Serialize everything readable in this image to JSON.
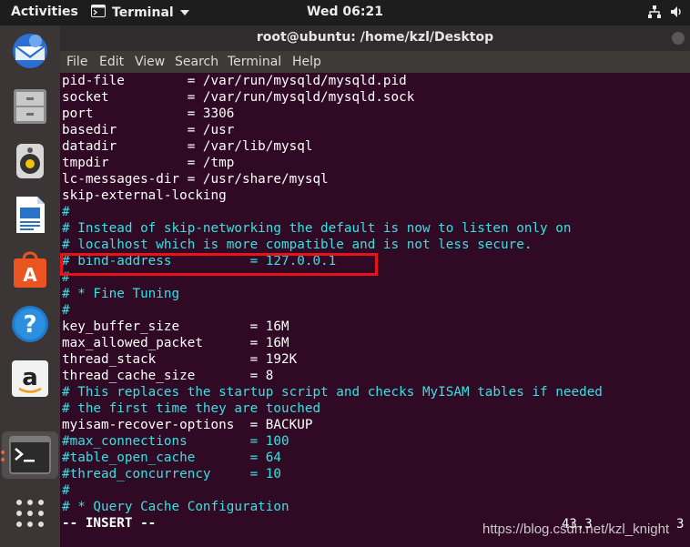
{
  "topbar": {
    "activities": "Activities",
    "app_name": "Terminal",
    "clock": "Wed 06:21"
  },
  "window": {
    "title": "root@ubuntu: /home/kzl/Desktop",
    "menu": [
      "File",
      "Edit",
      "View",
      "Search",
      "Terminal",
      "Help"
    ]
  },
  "dock": {
    "items": [
      "thunderbird-icon",
      "files-icon",
      "rhythmbox-icon",
      "writer-icon",
      "software-center-icon",
      "help-icon",
      "amazon-icon",
      "terminal-icon",
      "show-apps-icon"
    ]
  },
  "terminal": {
    "lines": [
      {
        "text": "pid-file        = /var/run/mysqld/mysqld.pid",
        "kind": "plain"
      },
      {
        "text": "socket          = /var/run/mysqld/mysqld.sock",
        "kind": "plain"
      },
      {
        "text": "port            = 3306",
        "kind": "plain"
      },
      {
        "text": "basedir         = /usr",
        "kind": "plain"
      },
      {
        "text": "datadir         = /var/lib/mysql",
        "kind": "plain"
      },
      {
        "text": "tmpdir          = /tmp",
        "kind": "plain"
      },
      {
        "text": "lc-messages-dir = /usr/share/mysql",
        "kind": "plain"
      },
      {
        "text": "skip-external-locking",
        "kind": "plain"
      },
      {
        "text": "#",
        "kind": "comment"
      },
      {
        "text": "# Instead of skip-networking the default is now to listen only on",
        "kind": "comment"
      },
      {
        "text": "# localhost which is more compatible and is not less secure.",
        "kind": "comment"
      },
      {
        "text": "# bind-address          = 127.0.0.1",
        "kind": "comment"
      },
      {
        "text": "#",
        "kind": "comment"
      },
      {
        "text": "# * Fine Tuning",
        "kind": "comment"
      },
      {
        "text": "#",
        "kind": "comment"
      },
      {
        "text": "key_buffer_size         = 16M",
        "kind": "plain"
      },
      {
        "text": "max_allowed_packet      = 16M",
        "kind": "plain"
      },
      {
        "text": "thread_stack            = 192K",
        "kind": "plain"
      },
      {
        "text": "thread_cache_size       = 8",
        "kind": "plain"
      },
      {
        "text": "# This replaces the startup script and checks MyISAM tables if needed",
        "kind": "comment"
      },
      {
        "text": "# the first time they are touched",
        "kind": "comment"
      },
      {
        "text": "myisam-recover-options  = BACKUP",
        "kind": "plain"
      },
      {
        "text": "#max_connections        = 100",
        "kind": "comment"
      },
      {
        "text": "#table_open_cache       = 64",
        "kind": "comment"
      },
      {
        "text": "#thread_concurrency     = 10",
        "kind": "comment"
      },
      {
        "text": "#",
        "kind": "comment"
      },
      {
        "text": "# * Query Cache Configuration",
        "kind": "comment"
      },
      {
        "text": "-- INSERT --",
        "kind": "mode"
      }
    ],
    "cursor_position": "43,3",
    "scroll_percent": "3"
  },
  "watermark": "https://blog.csdn.net/kzl_knight",
  "colors": {
    "terminal_bg": "#300a24",
    "comment": "#34e2e2",
    "highlight_box": "#e8121a"
  }
}
